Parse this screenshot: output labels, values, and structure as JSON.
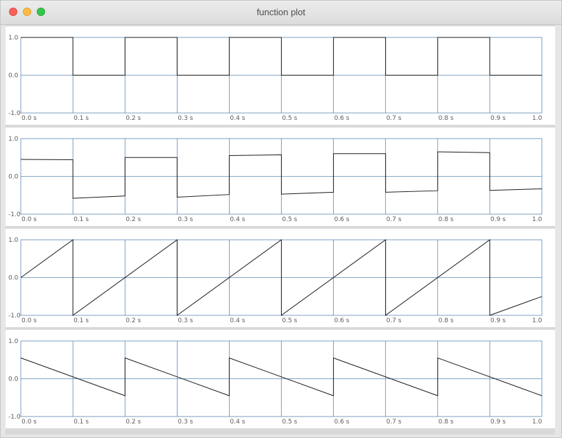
{
  "window": {
    "title": "function plot",
    "accent": "#5b87b2"
  },
  "plots": [
    {
      "name": "plot-square",
      "y_tick_labels": [
        "1.0",
        "0.0",
        "-1.0"
      ],
      "x_tick_labels": [
        "0.0 s",
        "0.1 s",
        "0.2 s",
        "0.3 s",
        "0.4 s",
        "0.5 s",
        "0.6 s",
        "0.7 s",
        "0.8 s",
        "0.9 s",
        "1.0"
      ]
    },
    {
      "name": "plot-square-fourier",
      "y_tick_labels": [
        "1.0",
        "0.0",
        "-1.0"
      ],
      "x_tick_labels": [
        "0.0 s",
        "0.1 s",
        "0.2 s",
        "0.3 s",
        "0.4 s",
        "0.5 s",
        "0.6 s",
        "0.7 s",
        "0.8 s",
        "0.9 s",
        "1.0"
      ]
    },
    {
      "name": "plot-sawtooth",
      "y_tick_labels": [
        "1.0",
        "0.0",
        "-1.0"
      ],
      "x_tick_labels": [
        "0.0 s",
        "0.1 s",
        "0.2 s",
        "0.3 s",
        "0.4 s",
        "0.5 s",
        "0.6 s",
        "0.7 s",
        "0.8 s",
        "0.9 s",
        "1.0"
      ]
    },
    {
      "name": "plot-ramp",
      "y_tick_labels": [
        "1.0",
        "0.0",
        "-1.0"
      ],
      "x_tick_labels": [
        "0.0 s",
        "0.1 s",
        "0.2 s",
        "0.3 s",
        "0.4 s",
        "0.5 s",
        "0.6 s",
        "0.7 s",
        "0.8 s",
        "0.9 s",
        "1.0"
      ]
    }
  ],
  "chart_data": [
    {
      "type": "line",
      "xlim": [
        0,
        1
      ],
      "ylim": [
        -1,
        1
      ],
      "grid": true,
      "x": [
        0.0,
        0.1,
        0.1,
        0.2,
        0.2,
        0.3,
        0.3,
        0.4,
        0.4,
        0.5,
        0.5,
        0.6,
        0.6,
        0.7,
        0.7,
        0.8,
        0.8,
        0.9,
        0.9,
        1.0
      ],
      "y": [
        1.0,
        1.0,
        0.0,
        0.0,
        1.0,
        1.0,
        0.0,
        0.0,
        1.0,
        1.0,
        0.0,
        0.0,
        1.0,
        1.0,
        0.0,
        0.0,
        1.0,
        1.0,
        0.0,
        0.0
      ]
    },
    {
      "type": "line",
      "xlim": [
        0,
        1
      ],
      "ylim": [
        -1,
        1
      ],
      "grid": true,
      "x": [
        0.0,
        0.1,
        0.1,
        0.2,
        0.2,
        0.3,
        0.3,
        0.4,
        0.4,
        0.5,
        0.5,
        0.6,
        0.6,
        0.7,
        0.7,
        0.8,
        0.8,
        0.9,
        0.9,
        1.0
      ],
      "y": [
        0.45,
        0.44,
        -0.58,
        -0.52,
        0.5,
        0.5,
        -0.55,
        -0.48,
        0.55,
        0.57,
        -0.47,
        -0.42,
        0.6,
        0.6,
        -0.42,
        -0.38,
        0.65,
        0.63,
        -0.37,
        -0.33
      ]
    },
    {
      "type": "line",
      "xlim": [
        0,
        1
      ],
      "ylim": [
        -1,
        1
      ],
      "grid": true,
      "x": [
        0.0,
        0.1,
        0.1,
        0.3,
        0.3,
        0.5,
        0.5,
        0.7,
        0.7,
        0.9,
        0.9,
        1.0
      ],
      "y": [
        0.0,
        1.0,
        -1.0,
        1.0,
        -1.0,
        1.0,
        -1.0,
        1.0,
        -1.0,
        1.0,
        -1.0,
        -0.5
      ]
    },
    {
      "type": "line",
      "xlim": [
        0,
        1
      ],
      "ylim": [
        -1,
        1
      ],
      "grid": true,
      "x": [
        0.0,
        0.2,
        0.2,
        0.4,
        0.4,
        0.6,
        0.6,
        0.8,
        0.8,
        1.0
      ],
      "y": [
        0.55,
        -0.45,
        0.55,
        -0.45,
        0.55,
        -0.45,
        0.55,
        -0.45,
        0.55,
        -0.45
      ]
    }
  ]
}
